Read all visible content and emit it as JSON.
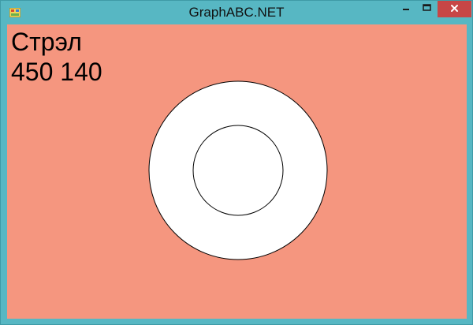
{
  "window": {
    "title": "GraphABC.NET",
    "icon": "app-icon",
    "controls": {
      "minimize_label": "-",
      "maximize_icon": "maximize-icon",
      "close_label": "×",
      "close_color": "#c74646"
    },
    "frame_color": "#57b7c3"
  },
  "canvas": {
    "background": "#f5967f",
    "text_line1": "Стрэл",
    "text_line2": "450 140",
    "shapes": {
      "outer_circle": {
        "fill": "#ffffff",
        "stroke": "#000000"
      },
      "inner_circle": {
        "fill": "#ffffff",
        "stroke": "#000000"
      }
    }
  }
}
